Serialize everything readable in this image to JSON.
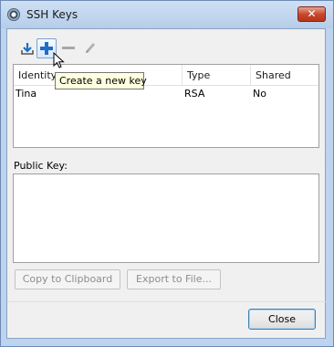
{
  "window": {
    "title": "SSH Keys",
    "close_glyph": "✕"
  },
  "toolbar": {
    "buttons": [
      {
        "icon": "import-key-icon",
        "enabled": true
      },
      {
        "icon": "add-key-icon",
        "enabled": true,
        "hovered": true
      },
      {
        "icon": "remove-key-icon",
        "enabled": false
      },
      {
        "icon": "edit-key-icon",
        "enabled": false
      }
    ],
    "tooltip": "Create a new key"
  },
  "keys_table": {
    "columns": [
      "Identity",
      "Type",
      "Shared"
    ],
    "rows": [
      {
        "identity": "Tina",
        "type": "RSA",
        "shared": "No"
      }
    ]
  },
  "public_key": {
    "label": "Public Key:",
    "value": ""
  },
  "actions": {
    "copy_label": "Copy to Clipboard",
    "export_label": "Export to File...",
    "close_label": "Close"
  },
  "colors": {
    "accent": "#3c7fb1",
    "icon_blue": "#1e6fc7"
  }
}
